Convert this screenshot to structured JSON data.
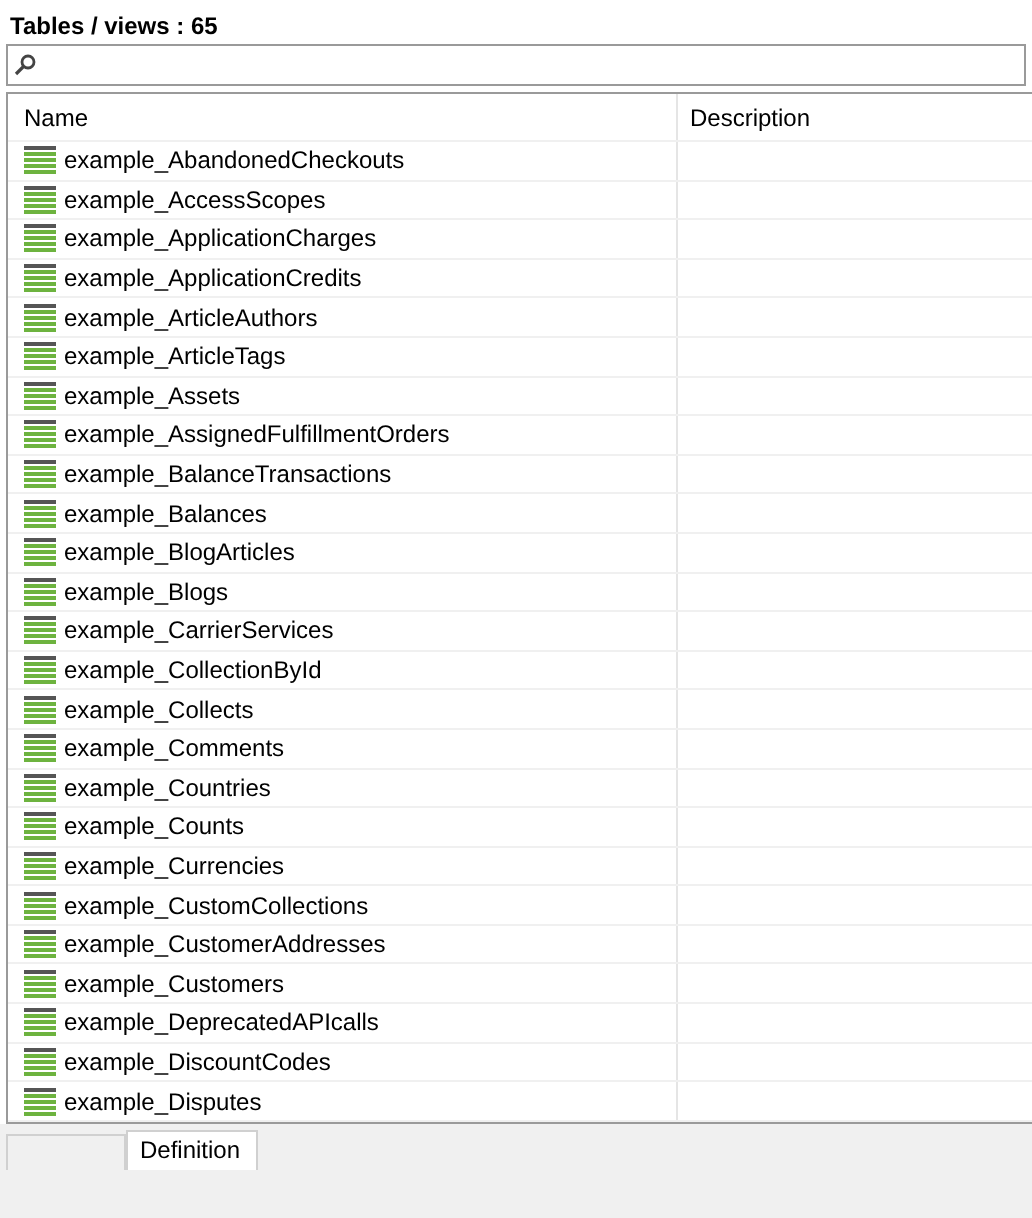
{
  "title": "Tables / views : 65",
  "table": {
    "columns": [
      "Name",
      "Description"
    ],
    "rows": [
      {
        "name": "example_AbandonedCheckouts"
      },
      {
        "name": "example_AccessScopes"
      },
      {
        "name": "example_ApplicationCharges"
      },
      {
        "name": "example_ApplicationCredits"
      },
      {
        "name": "example_ArticleAuthors"
      },
      {
        "name": "example_ArticleTags"
      },
      {
        "name": "example_Assets"
      },
      {
        "name": "example_AssignedFulfillmentOrders"
      },
      {
        "name": "example_BalanceTransactions"
      },
      {
        "name": "example_Balances"
      },
      {
        "name": "example_BlogArticles"
      },
      {
        "name": "example_Blogs"
      },
      {
        "name": "example_CarrierServices"
      },
      {
        "name": "example_CollectionById"
      },
      {
        "name": "example_Collects"
      },
      {
        "name": "example_Comments"
      },
      {
        "name": "example_Countries"
      },
      {
        "name": "example_Counts"
      },
      {
        "name": "example_Currencies"
      },
      {
        "name": "example_CustomCollections"
      },
      {
        "name": "example_CustomerAddresses"
      },
      {
        "name": "example_Customers"
      },
      {
        "name": "example_DeprecatedAPIcalls"
      },
      {
        "name": "example_DiscountCodes"
      },
      {
        "name": "example_Disputes"
      }
    ]
  },
  "bottom_tabs": [
    {
      "selected": false
    },
    {
      "label": "Definition",
      "selected": true
    }
  ]
}
